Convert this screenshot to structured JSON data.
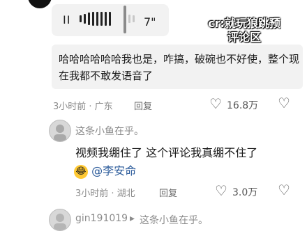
{
  "voice": {
    "play_symbol": "II",
    "duration": "7\""
  },
  "watermark": {
    "line1": "cr:就玩狼跳预",
    "line2": "评论区"
  },
  "reply_quote": {
    "text": "哈哈哈哈哈哈我也是，咋搞，破碗也不好使，整个现在我都不敢发语音了"
  },
  "comment1_meta": {
    "time_location": "3小时前 · 广东",
    "reply_label": "回复",
    "like_count": "16.8万"
  },
  "comment2": {
    "username": "这条小鱼在乎。",
    "text": "视频我绷住了  这个评论我真绷不住了",
    "emoji": "😂",
    "mention": "@李安命",
    "time_location": "3小时前 · 湖北",
    "reply_label": "回复",
    "like_count": "3.0万"
  },
  "comment3": {
    "username": "gin191019",
    "arrow": "▸",
    "reply_to": "这条小鱼在乎。"
  }
}
